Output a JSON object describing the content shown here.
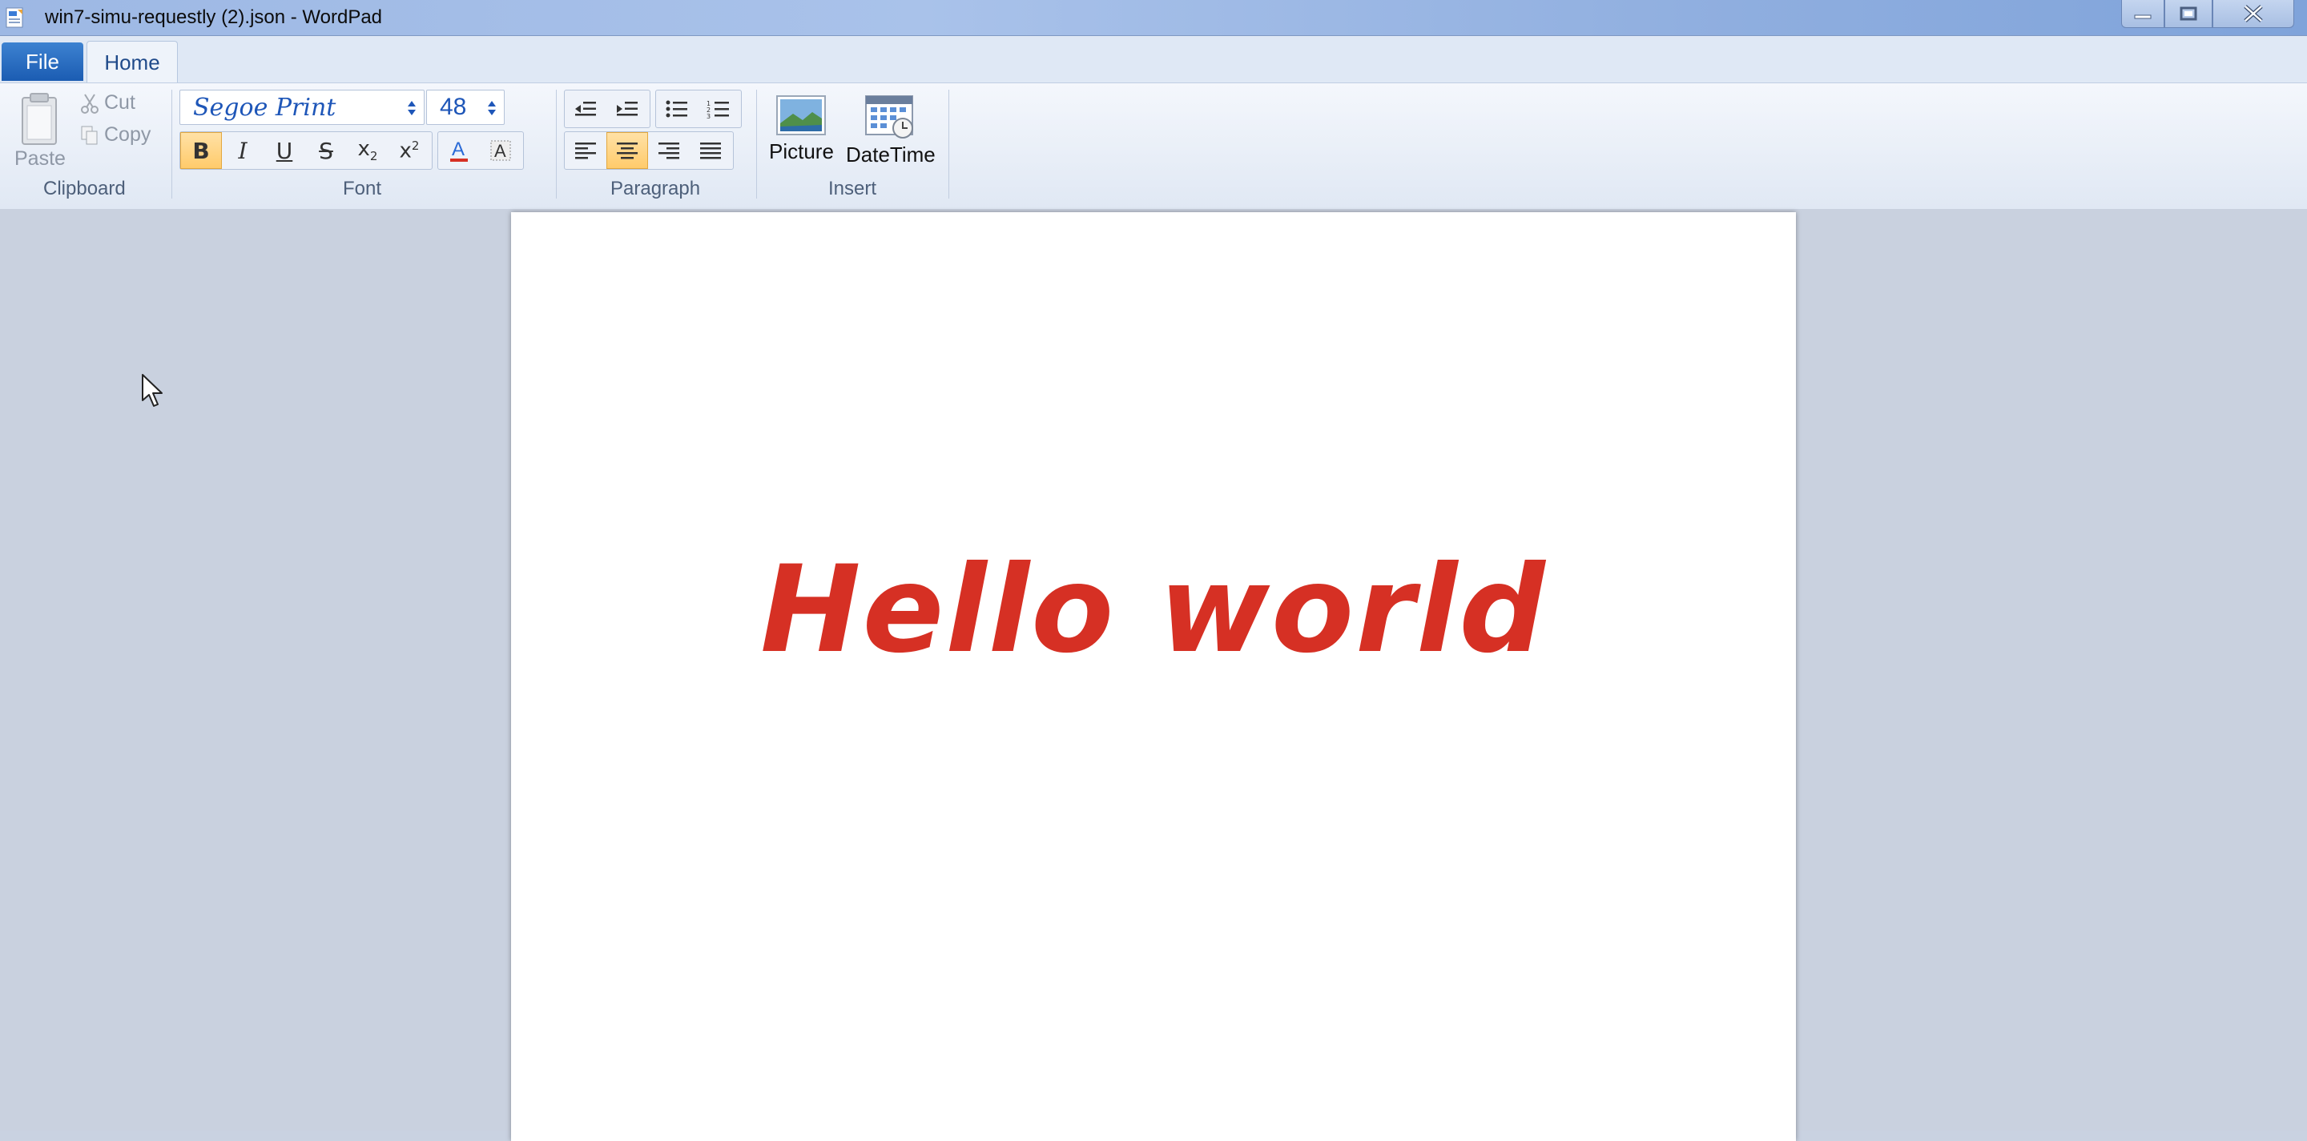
{
  "window": {
    "title": "win7-simu-requestly (2).json - WordPad"
  },
  "tabs": {
    "file": "File",
    "home": "Home"
  },
  "clipboard": {
    "paste": "Paste",
    "cut": "Cut",
    "copy": "Copy",
    "group_label": "Clipboard"
  },
  "font": {
    "family": "Segoe Print",
    "size": "48",
    "group_label": "Font",
    "bold_active": true,
    "color": "#d63024"
  },
  "paragraph": {
    "group_label": "Paragraph",
    "alignment": "center"
  },
  "insert": {
    "picture": "Picture",
    "datetime": "DateTime",
    "group_label": "Insert"
  },
  "document": {
    "text": "Hello world"
  }
}
